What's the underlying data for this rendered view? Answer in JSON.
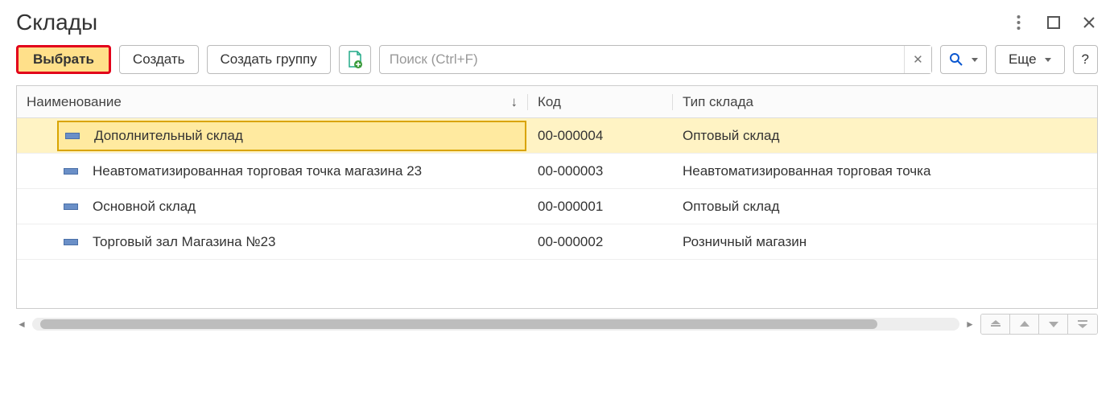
{
  "title": "Склады",
  "toolbar": {
    "select_label": "Выбрать",
    "create_label": "Создать",
    "create_group_label": "Создать группу",
    "more_label": "Еще",
    "help_label": "?"
  },
  "search": {
    "placeholder": "Поиск (Ctrl+F)",
    "value": ""
  },
  "table": {
    "columns": {
      "name": "Наименование",
      "code": "Код",
      "type": "Тип склада"
    },
    "rows": [
      {
        "name": "Дополнительный склад",
        "code": "00-000004",
        "type": "Оптовый склад",
        "selected": true
      },
      {
        "name": "Неавтоматизированная торговая точка магазина 23",
        "code": "00-000003",
        "type": "Неавтоматизированная торговая точка",
        "selected": false
      },
      {
        "name": "Основной склад",
        "code": "00-000001",
        "type": "Оптовый склад",
        "selected": false
      },
      {
        "name": "Торговый зал Магазина №23",
        "code": "00-000002",
        "type": "Розничный магазин",
        "selected": false
      }
    ]
  }
}
